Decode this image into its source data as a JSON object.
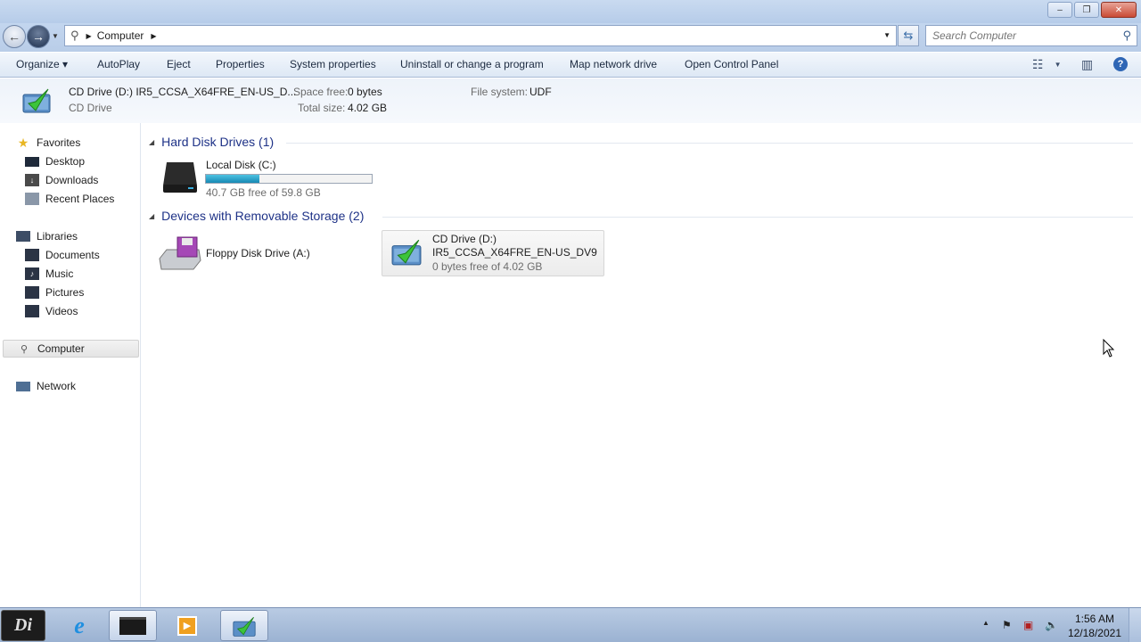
{
  "window": {
    "minimize_glyph": "–",
    "maximize_glyph": "❐",
    "close_glyph": "✕"
  },
  "address": {
    "segment": "Computer",
    "search_placeholder": "Search Computer"
  },
  "toolbar": {
    "organize": "Organize ▾",
    "autoplay": "AutoPlay",
    "eject": "Eject",
    "properties": "Properties",
    "system_properties": "System properties",
    "uninstall": "Uninstall or change a program",
    "map_network": "Map network drive",
    "open_control_panel": "Open Control Panel"
  },
  "details": {
    "name": "CD Drive (D:) IR5_CCSA_X64FRE_EN-US_D...",
    "type": "CD Drive",
    "space_free_label": "Space free:",
    "space_free_value": "0 bytes",
    "total_size_label": "Total size:",
    "total_size_value": "4.02 GB",
    "fs_label": "File system:",
    "fs_value": "UDF"
  },
  "nav": {
    "favorites": "Favorites",
    "desktop": "Desktop",
    "downloads": "Downloads",
    "recent": "Recent Places",
    "libraries": "Libraries",
    "documents": "Documents",
    "music": "Music",
    "pictures": "Pictures",
    "videos": "Videos",
    "computer": "Computer",
    "network": "Network"
  },
  "groups": {
    "hdd": "Hard Disk Drives (1)",
    "removable": "Devices with Removable Storage (2)"
  },
  "drives": {
    "c_name": "Local Disk (C:)",
    "c_free": "40.7 GB free of 59.8 GB",
    "c_used_fraction": 0.32,
    "a_name": "Floppy Disk Drive (A:)",
    "d_name": "CD Drive (D:)",
    "d_label": "IR5_CCSA_X64FRE_EN-US_DV9",
    "d_free": "0 bytes free of 4.02 GB"
  },
  "taskbar": {
    "time": "1:56 AM",
    "date": "12/18/2021"
  },
  "colors": {
    "group_header": "#1e3287",
    "bar_fill": "#1689b4"
  }
}
